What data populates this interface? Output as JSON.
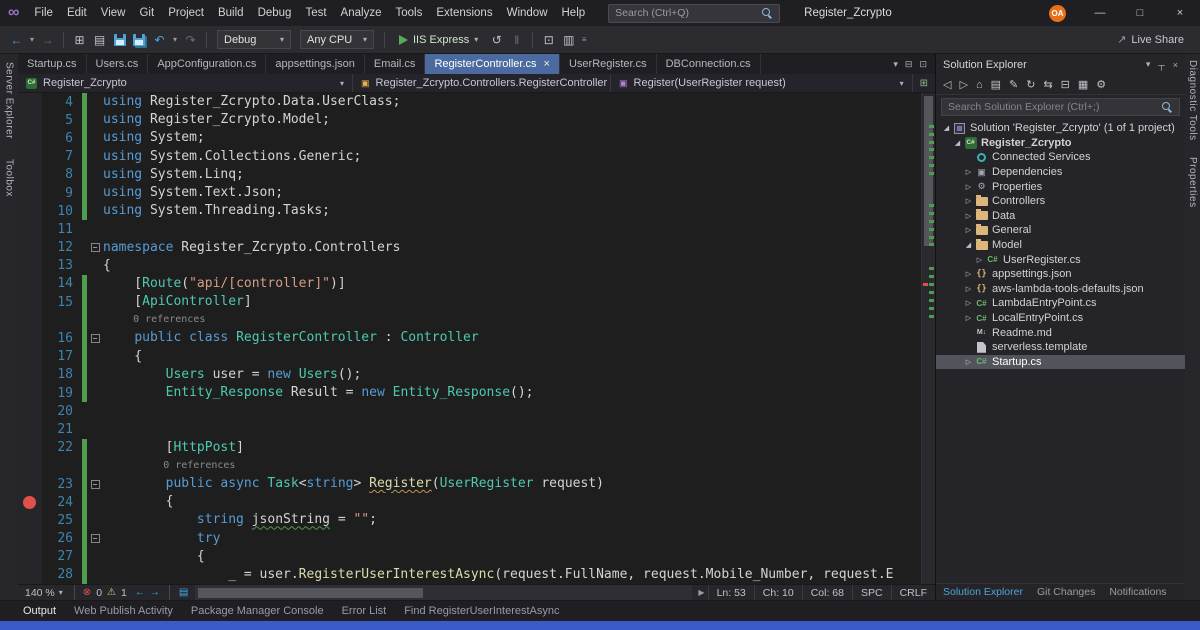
{
  "colors": {
    "tab_active": "#4b6ba0",
    "status_bar": "#3a5bc8",
    "breakpoint": "#e2504c",
    "change_bar": "#4f9e50",
    "avatar": "#e8701a",
    "keyword": "#569cd6",
    "type": "#4ec9b0",
    "string": "#d69d85",
    "method": "#dcdcaa",
    "line_number": "#3e84ae",
    "run_green": "#57ab57",
    "selection_gray": "#51545a"
  },
  "titlebar": {
    "logo": "∞",
    "menus": [
      "File",
      "Edit",
      "View",
      "Git",
      "Project",
      "Build",
      "Debug",
      "Test",
      "Analyze",
      "Tools",
      "Extensions",
      "Window",
      "Help"
    ],
    "search_placeholder": "Search (Ctrl+Q)",
    "window_title": "Register_Zcrypto",
    "avatar": "OA",
    "window_controls": {
      "minimize": "—",
      "maximize": "□",
      "close": "×"
    }
  },
  "toolbar": {
    "items": [
      {
        "t": "i",
        "n": "navigate-backward-icon",
        "g": "←",
        "cls": "accent"
      },
      {
        "t": "i",
        "n": "navigate-back-chevron-icon",
        "g": "▾",
        "cls": "mini"
      },
      {
        "t": "i",
        "n": "navigate-forward-icon",
        "g": "→",
        "cls": "dim"
      },
      {
        "t": "s"
      },
      {
        "t": "i",
        "n": "new-project-icon",
        "g": "⊞"
      },
      {
        "t": "i",
        "n": "open-file-icon",
        "g": "▤"
      },
      {
        "t": "i",
        "n": "save-icon",
        "css": "icn-floppy"
      },
      {
        "t": "i",
        "n": "save-all-icon",
        "css": "icn-floppy all"
      },
      {
        "t": "i",
        "n": "undo-icon",
        "g": "↶",
        "cls": "accent"
      },
      {
        "t": "i",
        "n": "undo-chevron-icon",
        "g": "▾",
        "cls": "mini"
      },
      {
        "t": "i",
        "n": "redo-icon",
        "g": "↷",
        "cls": "dim"
      },
      {
        "t": "s"
      },
      {
        "t": "d",
        "n": "solution-configurations-dropdown",
        "label": "Debug"
      },
      {
        "t": "d",
        "n": "solution-platforms-dropdown",
        "label": "Any CPU"
      },
      {
        "t": "s"
      },
      {
        "t": "run",
        "n": "start-debugging-button",
        "label": "IIS Express"
      },
      {
        "t": "i",
        "n": "hot-reload-icon",
        "g": "↺"
      },
      {
        "t": "i",
        "n": "break-all-icon",
        "g": "‖",
        "cls": "dim"
      },
      {
        "t": "s"
      },
      {
        "t": "i",
        "n": "attach-to-process-icon",
        "g": "⊡"
      },
      {
        "t": "i",
        "n": "find-in-files-icon",
        "g": "▥"
      },
      {
        "t": "i",
        "n": "toolbar-options-icon",
        "g": "≡",
        "cls": "mini"
      }
    ],
    "live_share": {
      "icon": "↗",
      "label": "Live Share"
    }
  },
  "tabbar": {
    "tabs": [
      {
        "label": "Startup.cs",
        "active": false
      },
      {
        "label": "Users.cs",
        "active": false
      },
      {
        "label": "AppConfiguration.cs",
        "active": false
      },
      {
        "label": "appsettings.json",
        "active": false
      },
      {
        "label": "Email.cs",
        "active": false
      },
      {
        "label": "RegisterController.cs",
        "active": true
      },
      {
        "label": "UserRegister.cs",
        "active": false
      },
      {
        "label": "DBConnection.cs",
        "active": false
      }
    ],
    "right_icons": [
      [
        "active-files-chevron-icon",
        "▾"
      ],
      [
        "split-window-icon",
        "⊟"
      ],
      [
        "float-window-icon",
        "⊡"
      ]
    ]
  },
  "breadcrumb": {
    "project": "Register_Zcrypto",
    "type": "Register_Zcrypto.Controllers.RegisterController",
    "member": "Register(UserRegister request)",
    "new_view_icon": "⊞"
  },
  "rails": {
    "left": [
      "Server Explorer",
      "Toolbox"
    ],
    "right": [
      "Diagnostic Tools",
      "Properties"
    ]
  },
  "editor": {
    "rows": [
      {
        "n": "4",
        "chg": 1,
        "tk": [
          [
            "k",
            "using "
          ],
          [
            "p",
            "Register_Zcrypto.Data.UserClass;"
          ]
        ]
      },
      {
        "n": "5",
        "chg": 1,
        "tk": [
          [
            "k",
            "using "
          ],
          [
            "p",
            "Register_Zcrypto.Model;"
          ]
        ]
      },
      {
        "n": "6",
        "chg": 1,
        "tk": [
          [
            "k",
            "using "
          ],
          [
            "p",
            "System;"
          ]
        ]
      },
      {
        "n": "7",
        "chg": 1,
        "tk": [
          [
            "k",
            "using "
          ],
          [
            "p",
            "System.Collections.Generic;"
          ]
        ]
      },
      {
        "n": "8",
        "chg": 1,
        "tk": [
          [
            "k",
            "using "
          ],
          [
            "p",
            "System.Linq;"
          ]
        ]
      },
      {
        "n": "9",
        "chg": 1,
        "tk": [
          [
            "k",
            "using "
          ],
          [
            "p",
            "System.Text.Json;"
          ]
        ]
      },
      {
        "n": "10",
        "chg": 1,
        "tk": [
          [
            "k",
            "using "
          ],
          [
            "p",
            "System.Threading.Tasks;"
          ]
        ]
      },
      {
        "n": "11",
        "tk": []
      },
      {
        "n": "12",
        "fold": 1,
        "tk": [
          [
            "k",
            "namespace "
          ],
          [
            "p",
            "Register_Zcrypto.Controllers"
          ]
        ]
      },
      {
        "n": "13",
        "tk": [
          [
            "p",
            "{"
          ]
        ]
      },
      {
        "n": "14",
        "chg": 1,
        "tk": [
          [
            "p",
            "    ["
          ],
          [
            "t",
            "Route"
          ],
          [
            "p",
            "("
          ],
          [
            "s",
            "\"api/[controller]\""
          ],
          [
            "p",
            ")]"
          ]
        ]
      },
      {
        "n": "15",
        "chg": 1,
        "tk": [
          [
            "p",
            "    ["
          ],
          [
            "t",
            "ApiController"
          ],
          [
            "p",
            "]"
          ]
        ]
      },
      {
        "lens": 1,
        "chg": 1,
        "tk": [
          [
            "c",
            "     0 references"
          ]
        ]
      },
      {
        "n": "16",
        "chg": 1,
        "fold": 1,
        "tk": [
          [
            "p",
            "    "
          ],
          [
            "k",
            "public class "
          ],
          [
            "t",
            "RegisterController"
          ],
          [
            "p",
            " : "
          ],
          [
            "t",
            "Controller"
          ]
        ]
      },
      {
        "n": "17",
        "chg": 1,
        "tk": [
          [
            "p",
            "    {"
          ]
        ]
      },
      {
        "n": "18",
        "chg": 1,
        "tk": [
          [
            "p",
            "        "
          ],
          [
            "t",
            "Users"
          ],
          [
            "p",
            " user = "
          ],
          [
            "k",
            "new"
          ],
          [
            "p",
            " "
          ],
          [
            "t",
            "Users"
          ],
          [
            "p",
            "();"
          ]
        ]
      },
      {
        "n": "19",
        "chg": 1,
        "tk": [
          [
            "p",
            "        "
          ],
          [
            "t",
            "Entity_Response"
          ],
          [
            "p",
            " Result = "
          ],
          [
            "k",
            "new"
          ],
          [
            "p",
            " "
          ],
          [
            "t",
            "Entity_Response"
          ],
          [
            "p",
            "();"
          ]
        ]
      },
      {
        "n": "20",
        "tk": []
      },
      {
        "n": "21",
        "tk": []
      },
      {
        "n": "22",
        "chg": 1,
        "tk": [
          [
            "p",
            "        ["
          ],
          [
            "t",
            "HttpPost"
          ],
          [
            "p",
            "]"
          ]
        ]
      },
      {
        "lens": 1,
        "chg": 1,
        "tk": [
          [
            "c",
            "          0 references"
          ]
        ]
      },
      {
        "n": "23",
        "chg": 1,
        "fold": 1,
        "tk": [
          [
            "p",
            "        "
          ],
          [
            "k",
            "public async "
          ],
          [
            "t",
            "Task"
          ],
          [
            "p",
            "<"
          ],
          [
            "k",
            "string"
          ],
          [
            "p",
            "> "
          ],
          [
            "m",
            "Register",
            "sqy"
          ],
          [
            "p",
            "("
          ],
          [
            "t",
            "UserRegister"
          ],
          [
            "p",
            " request)"
          ]
        ]
      },
      {
        "n": "24",
        "chg": 1,
        "bp": 1,
        "tk": [
          [
            "p",
            "        {"
          ]
        ]
      },
      {
        "n": "25",
        "chg": 1,
        "tk": [
          [
            "p",
            "            "
          ],
          [
            "k",
            "string"
          ],
          [
            "p",
            " "
          ],
          [
            "p",
            "jsonString",
            "sqg"
          ],
          [
            "p",
            " = "
          ],
          [
            "s",
            "\"\""
          ],
          [
            "p",
            ";"
          ]
        ]
      },
      {
        "n": "26",
        "chg": 1,
        "fold": 1,
        "tk": [
          [
            "p",
            "            "
          ],
          [
            "k",
            "try"
          ]
        ]
      },
      {
        "n": "27",
        "chg": 1,
        "tk": [
          [
            "p",
            "            {"
          ]
        ]
      },
      {
        "n": "28",
        "chg": 1,
        "tk": [
          [
            "p",
            "                _ = user."
          ],
          [
            "m",
            "RegisterUserInterestAsync"
          ],
          [
            "p",
            "(request.FullName, request.Mobile_Number, request.E"
          ]
        ]
      }
    ]
  },
  "status_strip": {
    "zoom": "140 %",
    "error_icon": "⊗",
    "error_count": "0",
    "warning_icon": "⚠",
    "warning_count": "1",
    "icons": [
      [
        "navigate-backward-icon",
        "←"
      ],
      [
        "navigate-forward-icon",
        "→"
      ],
      [
        "separator",
        ""
      ],
      [
        "messages-icon",
        "▤"
      ]
    ],
    "scroll_right_icon": "▶",
    "cells": [
      "Ln: 53",
      "Ch: 10",
      "Col: 68",
      "SPC",
      "CRLF"
    ]
  },
  "solution_explorer": {
    "title": "Solution Explorer",
    "header_icons": [
      [
        "window-position-icon",
        "▾"
      ],
      [
        "auto-hide-pin-icon",
        "┬"
      ],
      [
        "close-icon",
        "×"
      ]
    ],
    "toolbar_icons": [
      [
        "navigate-back-icon",
        "◁"
      ],
      [
        "navigate-forward-icon",
        "▷"
      ],
      [
        "home-icon",
        "⌂"
      ],
      [
        "switch-views-icon",
        "▤"
      ],
      [
        "pending-changes-filter-icon",
        "✎"
      ],
      [
        "refresh-icon",
        "↻"
      ],
      [
        "sync-with-active-document-icon",
        "⇆"
      ],
      [
        "collapse-all-icon",
        "⊟"
      ],
      [
        "show-all-files-icon",
        "▦"
      ],
      [
        "properties-icon",
        "⚙"
      ]
    ],
    "search_placeholder": "Search Solution Explorer (Ctrl+;)",
    "tree": [
      {
        "d": 0,
        "a": "down",
        "i": "sln",
        "label": "Solution 'Register_Zcrypto' (1 of 1 project)"
      },
      {
        "d": 1,
        "a": "down",
        "i": "proj",
        "label": "Register_Zcrypto",
        "bold": true
      },
      {
        "d": 2,
        "a": "none",
        "i": "plug",
        "label": "Connected Services"
      },
      {
        "d": 2,
        "a": "right",
        "i": "deps",
        "label": "Dependencies"
      },
      {
        "d": 2,
        "a": "right",
        "i": "props",
        "label": "Properties"
      },
      {
        "d": 2,
        "a": "right",
        "i": "folder",
        "label": "Controllers"
      },
      {
        "d": 2,
        "a": "right",
        "i": "folder",
        "label": "Data"
      },
      {
        "d": 2,
        "a": "right",
        "i": "folder",
        "label": "General"
      },
      {
        "d": 2,
        "a": "down",
        "i": "folder",
        "label": "Model"
      },
      {
        "d": 3,
        "a": "right",
        "i": "cs",
        "label": "UserRegister.cs"
      },
      {
        "d": 2,
        "a": "right",
        "i": "json",
        "label": "appsettings.json"
      },
      {
        "d": 2,
        "a": "right",
        "i": "json",
        "label": "aws-lambda-tools-defaults.json"
      },
      {
        "d": 2,
        "a": "right",
        "i": "cs",
        "label": "LambdaEntryPoint.cs"
      },
      {
        "d": 2,
        "a": "right",
        "i": "cs",
        "label": "LocalEntryPoint.cs"
      },
      {
        "d": 2,
        "a": "none",
        "i": "md",
        "label": "Readme.md"
      },
      {
        "d": 2,
        "a": "none",
        "i": "doc",
        "label": "serverless.template"
      },
      {
        "d": 2,
        "a": "right",
        "i": "cs",
        "label": "Startup.cs",
        "selected": true
      }
    ],
    "bottom_tabs": [
      {
        "label": "Solution Explorer",
        "active": true
      },
      {
        "label": "Git Changes",
        "active": false
      },
      {
        "label": "Notifications",
        "active": false
      }
    ]
  },
  "panel_tabs": [
    {
      "label": "Output",
      "active": true
    },
    {
      "label": "Web Publish Activity",
      "active": false
    },
    {
      "label": "Package Manager Console",
      "active": false
    },
    {
      "label": "Error List",
      "active": false
    },
    {
      "label": "Find RegisterUserInterestAsync",
      "active": false
    }
  ]
}
